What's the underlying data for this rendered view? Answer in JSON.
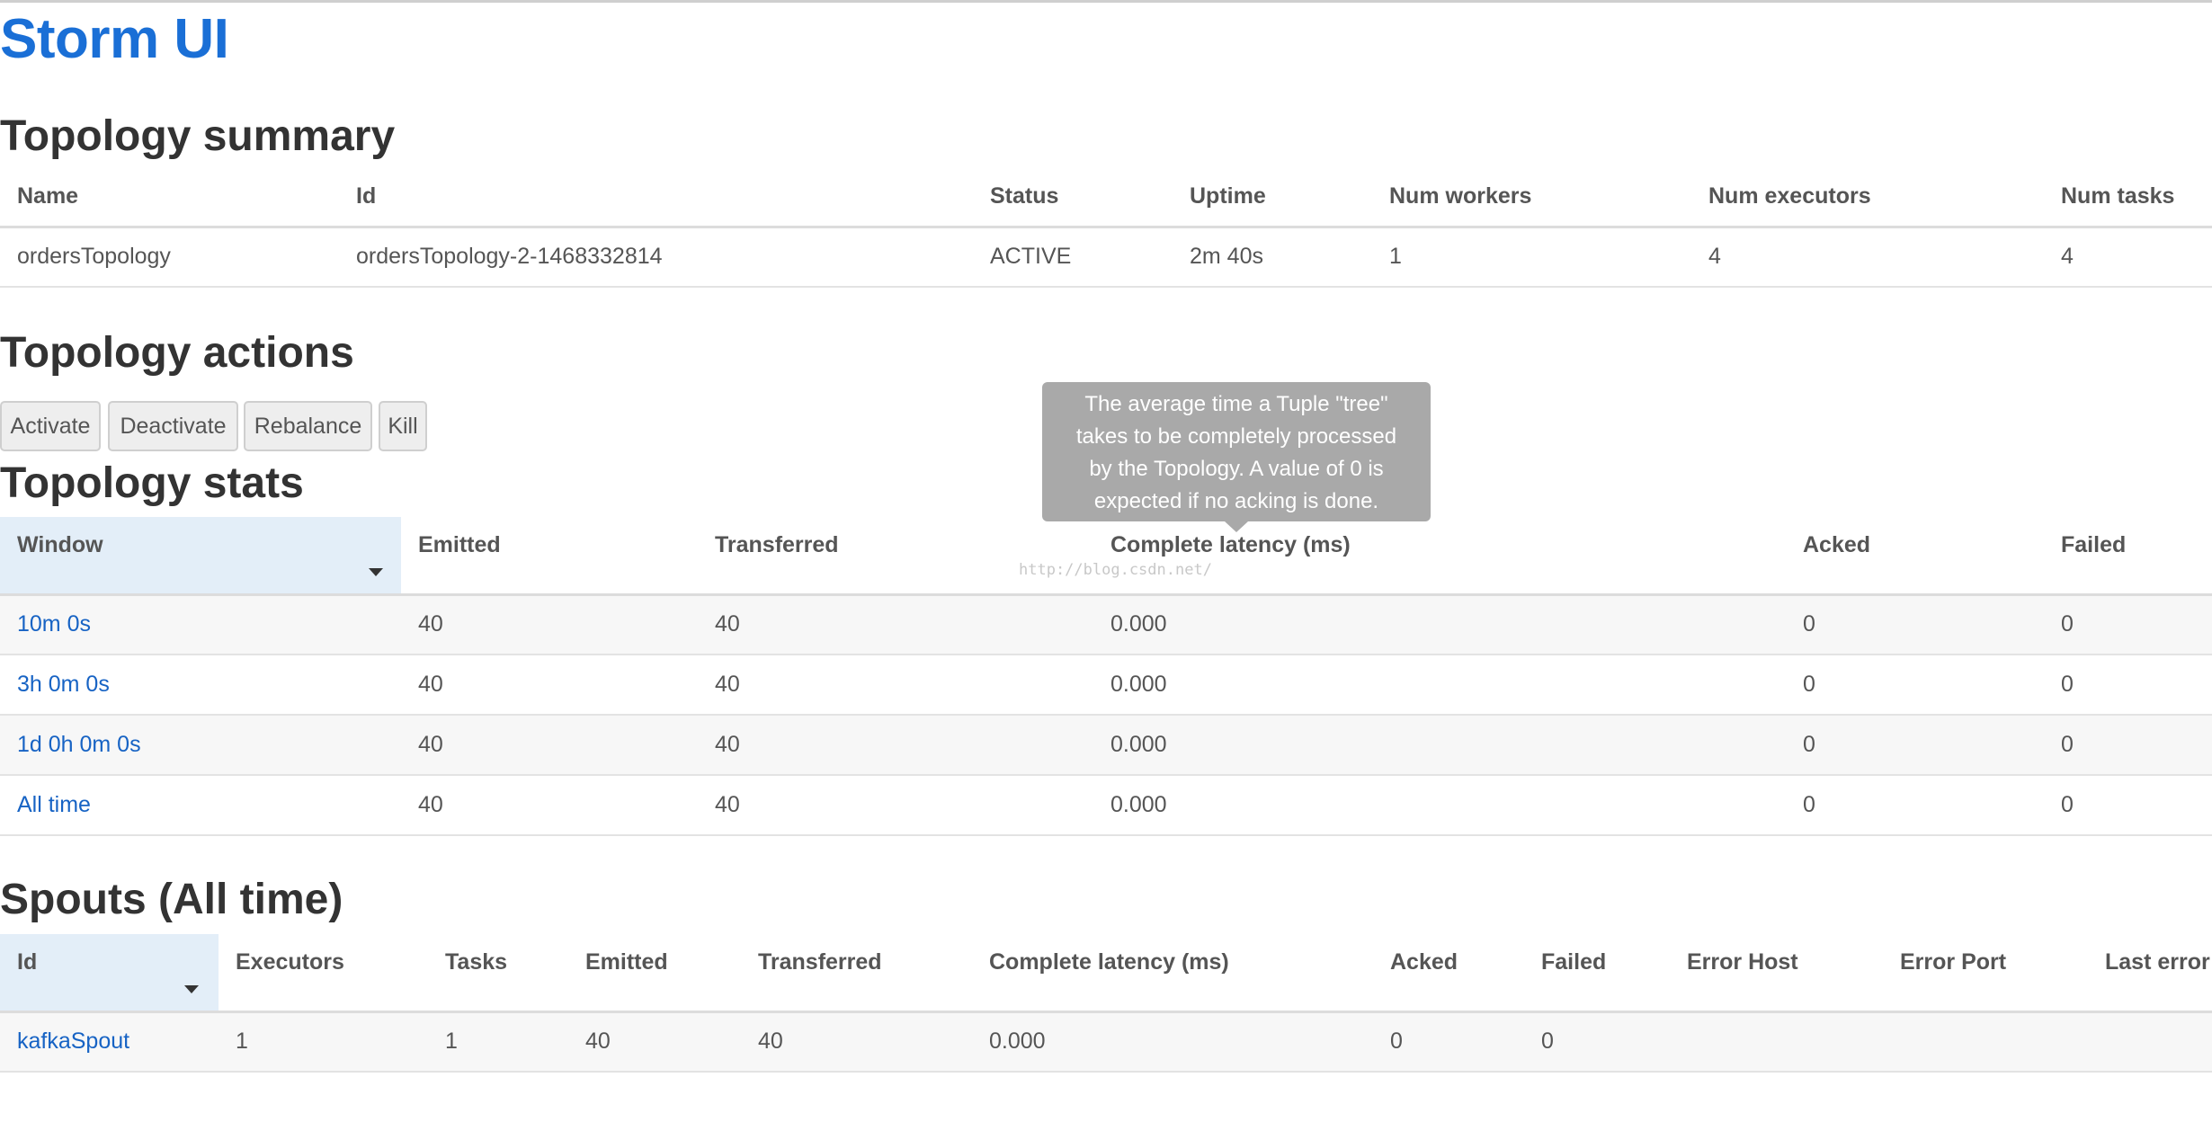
{
  "app_title": "Storm UI",
  "topology_summary": {
    "heading": "Topology summary",
    "columns": [
      "Name",
      "Id",
      "Status",
      "Uptime",
      "Num workers",
      "Num executors",
      "Num tasks"
    ],
    "row": [
      "ordersTopology",
      "ordersTopology-2-1468332814",
      "ACTIVE",
      "2m 40s",
      "1",
      "4",
      "4"
    ]
  },
  "topology_actions": {
    "heading": "Topology actions",
    "buttons": [
      "Activate",
      "Deactivate",
      "Rebalance",
      "Kill"
    ]
  },
  "topology_stats": {
    "heading": "Topology stats",
    "columns": [
      "Window",
      "Emitted",
      "Transferred",
      "Complete latency (ms)",
      "Acked",
      "Failed"
    ],
    "rows": [
      [
        "10m 0s",
        "40",
        "40",
        "0.000",
        "0",
        "0"
      ],
      [
        "3h 0m 0s",
        "40",
        "40",
        "0.000",
        "0",
        "0"
      ],
      [
        "1d 0h 0m 0s",
        "40",
        "40",
        "0.000",
        "0",
        "0"
      ],
      [
        "All time",
        "40",
        "40",
        "0.000",
        "0",
        "0"
      ]
    ]
  },
  "tooltip": {
    "lines": [
      "The average time a Tuple \"tree\"",
      "takes to be completely processed",
      "by the Topology. A value of 0 is",
      "expected if no acking is done."
    ]
  },
  "watermark": "http://blog.csdn.net/",
  "spouts": {
    "heading": "Spouts (All time)",
    "columns": [
      "Id",
      "Executors",
      "Tasks",
      "Emitted",
      "Transferred",
      "Complete latency (ms)",
      "Acked",
      "Failed",
      "Error Host",
      "Error Port",
      "Last error"
    ],
    "rows": [
      [
        "kafkaSpout",
        "1",
        "1",
        "40",
        "40",
        "0.000",
        "0",
        "0",
        "",
        "",
        ""
      ]
    ]
  },
  "colors": {
    "title_blue": "#1a6fd6",
    "link_blue": "#1763c4",
    "sorted_header_bg": "#e3eef8",
    "tooltip_bg": "#a9a9a9"
  }
}
